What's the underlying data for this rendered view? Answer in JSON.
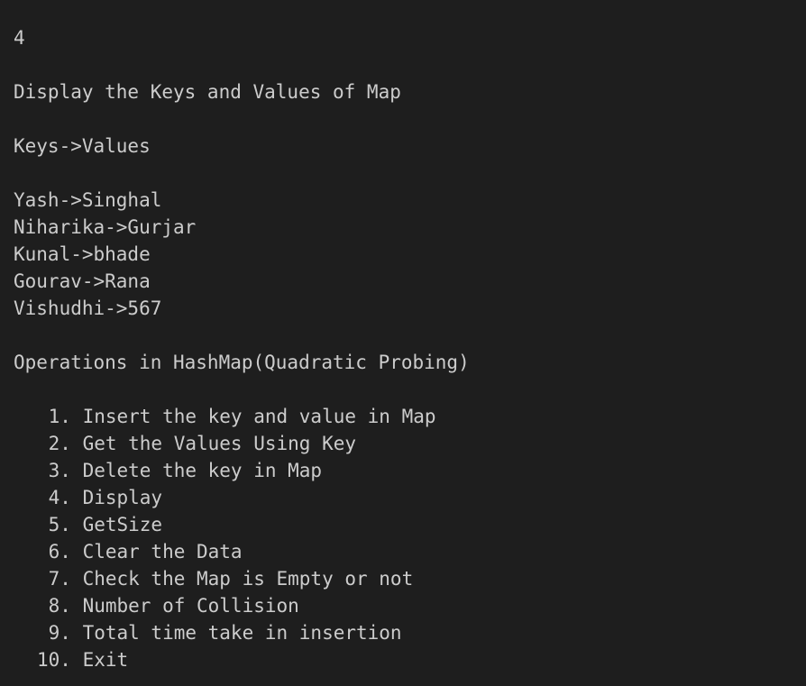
{
  "terminal": {
    "input_echo": "4",
    "display_header": "Display the Keys and Values of Map",
    "columns_header": "Keys->Values",
    "entries": [
      "Yash->Singhal",
      "Niharika->Gurjar",
      "Kunal->bhade",
      "Gourav->Rana",
      "Vishudhi->567"
    ],
    "menu_title": "Operations in HashMap(Quadratic Probing)",
    "menu_items": [
      " 1. Insert the key and value in Map",
      " 2. Get the Values Using Key",
      " 3. Delete the key in Map",
      " 4. Display",
      " 5. GetSize",
      " 6. Clear the Data",
      " 7. Check the Map is Empty or not",
      " 8. Number of Collision",
      " 9. Total time take in insertion",
      "10. Exit"
    ]
  },
  "colors": {
    "background": "#1e1e1e",
    "foreground": "#cccccc"
  }
}
